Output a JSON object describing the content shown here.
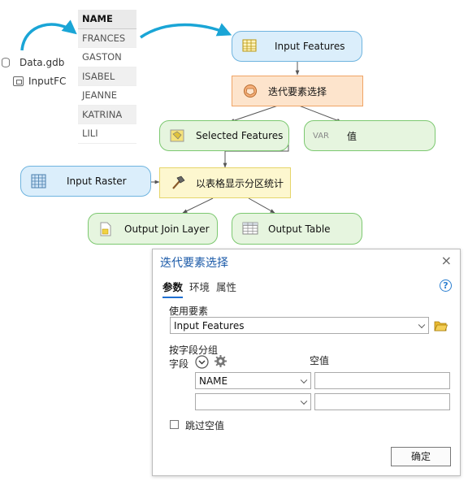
{
  "source": {
    "gdb": "Data.gdb",
    "feature_class": "InputFC"
  },
  "name_table": {
    "header": "NAME",
    "rows": [
      "FRANCES",
      "GASTON",
      "ISABEL",
      "JEANNE",
      "KATRINA",
      "LILI"
    ]
  },
  "model": {
    "input_features": "Input Features",
    "iterate_tool": "迭代要素选择",
    "selected_features": "Selected Features",
    "var_badge": "VAR",
    "value": "值",
    "input_raster": "Input Raster",
    "zonal_tool": "以表格显示分区统计",
    "output_join_layer": "Output Join Layer",
    "output_table": "Output Table"
  },
  "dialog": {
    "title": "迭代要素选择",
    "close": "×",
    "tabs": [
      "参数",
      "环境",
      "属性"
    ],
    "help": "?",
    "use_features_label": "使用要素",
    "use_features_value": "Input Features",
    "group_by_label": "按字段分组",
    "field_col_label": "字段",
    "null_col_label": "空值",
    "field_row1_value": "NAME",
    "field_row2_value": "",
    "skip_nulls_label": "跳过空值",
    "ok_label": "确定"
  },
  "colors": {
    "node_blue": "#dbeefb",
    "node_green": "#e6f5df",
    "node_orange": "#fde4cc",
    "node_yellow": "#fdf7cf",
    "arrow_accent": "#1aa5d6",
    "dialog_title": "#1b5aa8"
  }
}
